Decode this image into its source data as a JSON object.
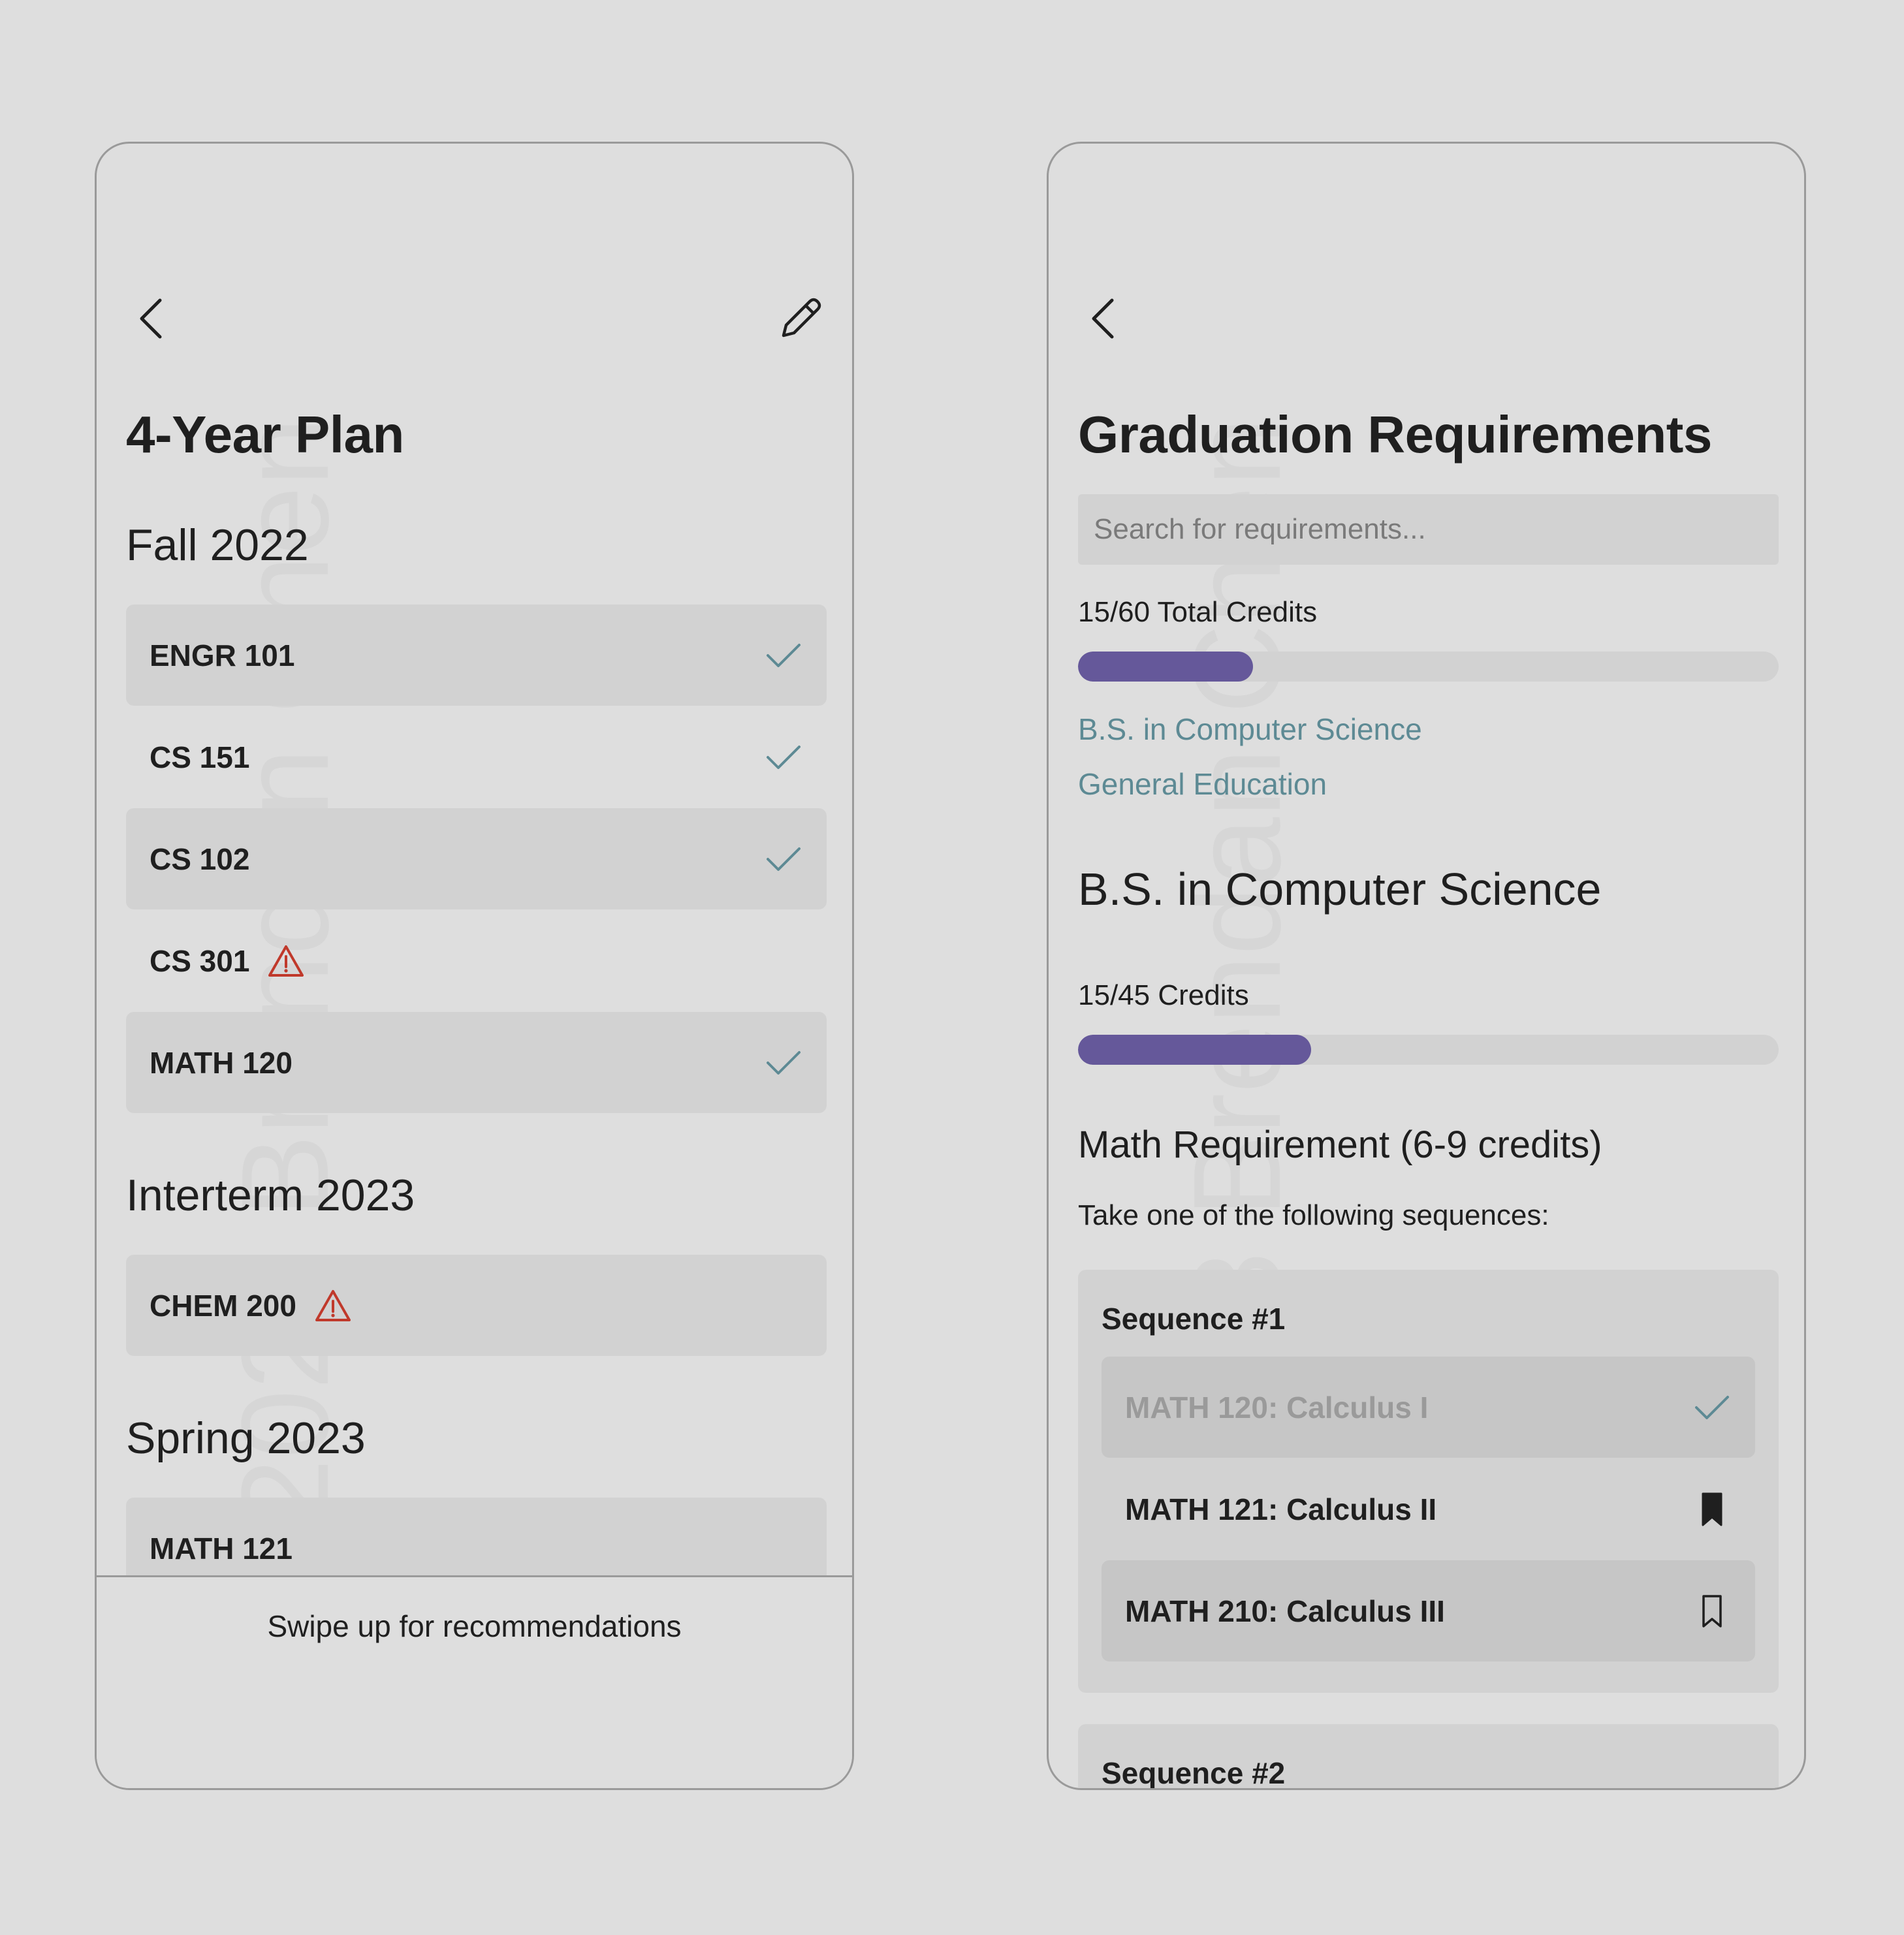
{
  "colors": {
    "background": "#dedede",
    "card": "#d2d2d2",
    "accent_progress": "#65589a",
    "link": "#5d8a94",
    "check": "#5d8a94",
    "warning": "#c0392b",
    "muted_text": "#9a9a9a"
  },
  "watermark": "©2023 Brendan Chen",
  "plan": {
    "title": "4-Year Plan",
    "terms": [
      {
        "name": "Fall 2022",
        "courses": [
          {
            "label": "ENGR 101",
            "status": "check-icon"
          },
          {
            "label": "CS 151",
            "status": "check-icon"
          },
          {
            "label": "CS 102",
            "status": "check-icon"
          },
          {
            "label": "CS 301",
            "status": "warning-icon"
          },
          {
            "label": "MATH 120",
            "status": "check-icon"
          }
        ]
      },
      {
        "name": "Interterm 2023",
        "courses": [
          {
            "label": "CHEM 200",
            "status": "warning-icon"
          }
        ]
      },
      {
        "name": "Spring 2023",
        "courses": [
          {
            "label": "MATH 121",
            "status": ""
          }
        ]
      }
    ],
    "bottom_hint": "Swipe up for recommendations"
  },
  "grad": {
    "title": "Graduation Requirements",
    "search_placeholder": "Search for requirements...",
    "total_credits_label": "15/60 Total Credits",
    "total_credits_fraction": 0.25,
    "links": [
      "B.S. in Computer Science",
      "General Education"
    ],
    "section_title": "B.S. in Computer Science",
    "section_credits_label": "15/45 Credits",
    "section_credits_fraction": 0.333,
    "math_req_title": "Math Requirement (6-9 credits)",
    "math_req_desc": "Take one of the following sequences:",
    "sequences": [
      {
        "title": "Sequence #1",
        "courses": [
          {
            "label": "MATH 120: Calculus I",
            "status": "check-icon"
          },
          {
            "label": "MATH 121: Calculus II",
            "status": "bookmark-filled-icon"
          },
          {
            "label": "MATH 210: Calculus III",
            "status": "bookmark-outline-icon"
          }
        ]
      },
      {
        "title": "Sequence #2"
      }
    ]
  }
}
